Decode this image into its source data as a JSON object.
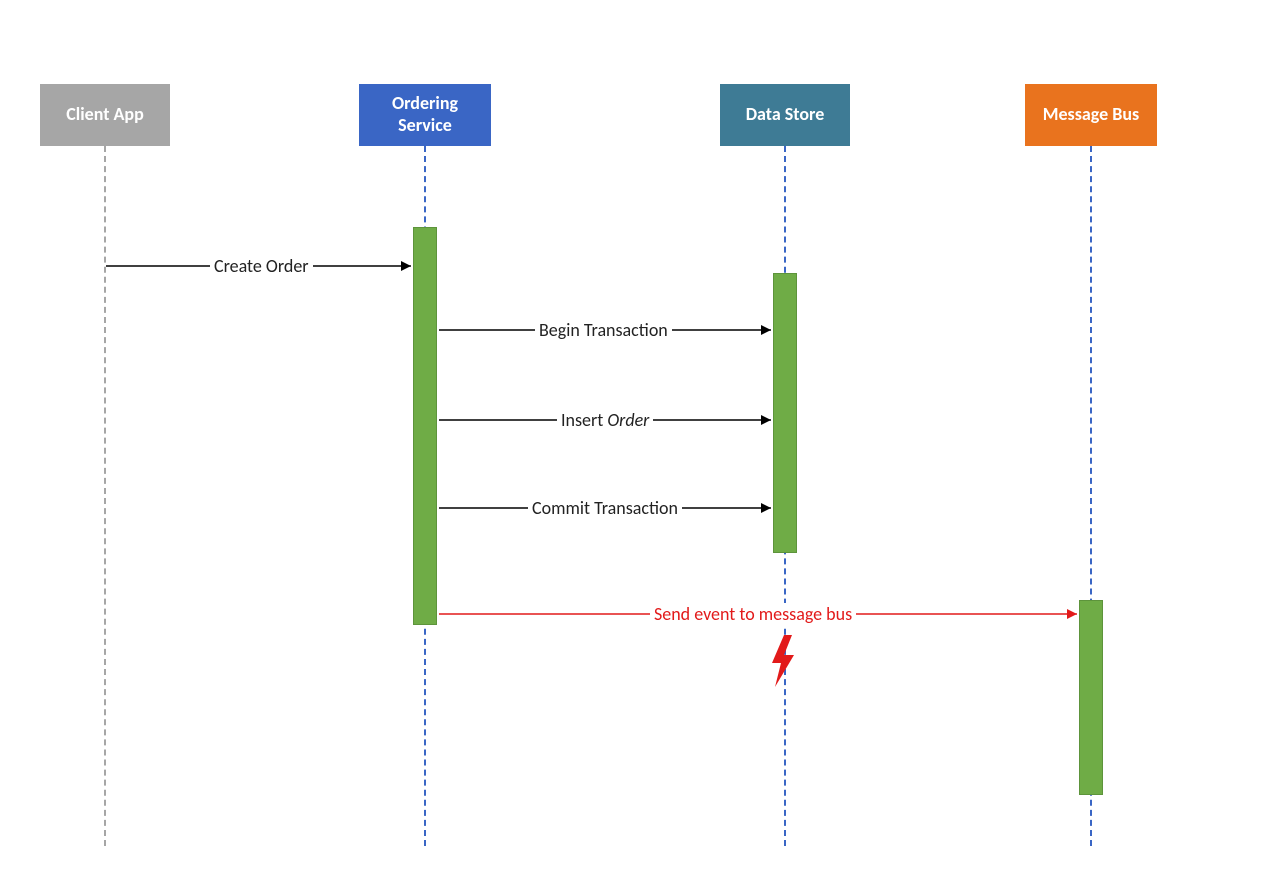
{
  "participants": {
    "client": {
      "label": "Client App",
      "color": "#a6a6a6"
    },
    "ordering": {
      "label": "Ordering Service",
      "color": "#3a66c5"
    },
    "datastore": {
      "label": "Data Store",
      "color": "#3e7b95"
    },
    "messagebus": {
      "label": "Message Bus",
      "color": "#e9731e"
    }
  },
  "messages": {
    "create_order": "Create Order",
    "begin_tx": "Begin Transaction",
    "insert_prefix": "Insert ",
    "insert_object": "Order",
    "commit_tx": "Commit Transaction",
    "send_event": "Send event to message bus"
  },
  "diagram": {
    "type": "sequence",
    "failure_indicated": true,
    "failure_on": "send_event"
  }
}
